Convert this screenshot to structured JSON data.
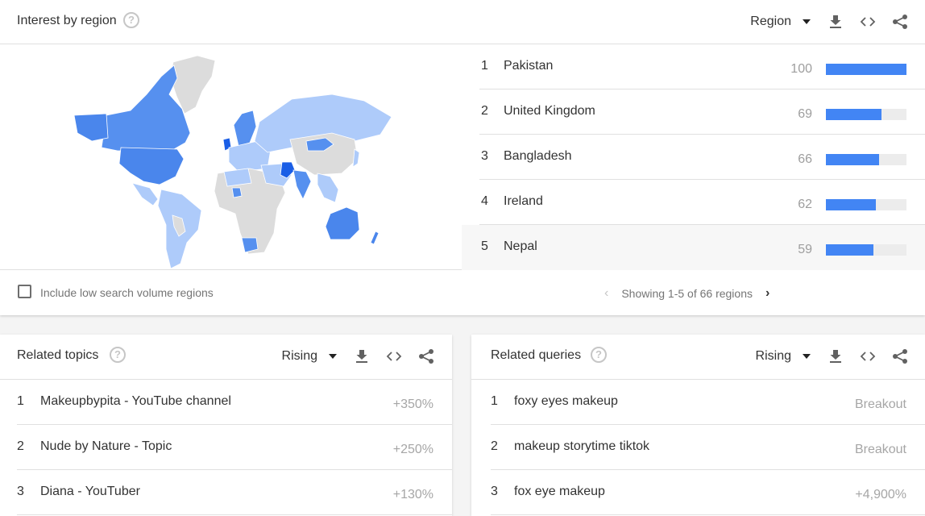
{
  "interest_by_region": {
    "title": "Interest by region",
    "selector_label": "Region",
    "icons": [
      "help-icon",
      "download-icon",
      "embed-icon",
      "share-icon"
    ],
    "rows": [
      {
        "rank": "1",
        "name": "Pakistan",
        "value": "100",
        "fraction": 1.0
      },
      {
        "rank": "2",
        "name": "United Kingdom",
        "value": "69",
        "fraction": 0.69
      },
      {
        "rank": "3",
        "name": "Bangladesh",
        "value": "66",
        "fraction": 0.66
      },
      {
        "rank": "4",
        "name": "Ireland",
        "value": "62",
        "fraction": 0.62
      },
      {
        "rank": "5",
        "name": "Nepal",
        "value": "59",
        "fraction": 0.59
      }
    ],
    "checkbox_label": "Include low search volume regions",
    "checkbox_checked": false,
    "pager_text": "Showing 1-5 of 66 regions",
    "colors": {
      "bar": "#4285f4",
      "track": "#ececec",
      "map_strong": "#1a5ee6",
      "map_mid": "#5690ef",
      "map_light": "#aecbfa",
      "map_none": "#dcdcdc"
    }
  },
  "related_topics": {
    "title": "Related topics",
    "selector_label": "Rising",
    "rows": [
      {
        "rank": "1",
        "name": "Makeupbypita - YouTube channel",
        "value": "+350%"
      },
      {
        "rank": "2",
        "name": "Nude by Nature - Topic",
        "value": "+250%"
      },
      {
        "rank": "3",
        "name": "Diana - YouTuber",
        "value": "+130%"
      }
    ]
  },
  "related_queries": {
    "title": "Related queries",
    "selector_label": "Rising",
    "rows": [
      {
        "rank": "1",
        "name": "foxy eyes makeup",
        "value": "Breakout"
      },
      {
        "rank": "2",
        "name": "makeup storytime tiktok",
        "value": "Breakout"
      },
      {
        "rank": "3",
        "name": "fox eye makeup",
        "value": "+4,900%"
      }
    ]
  }
}
